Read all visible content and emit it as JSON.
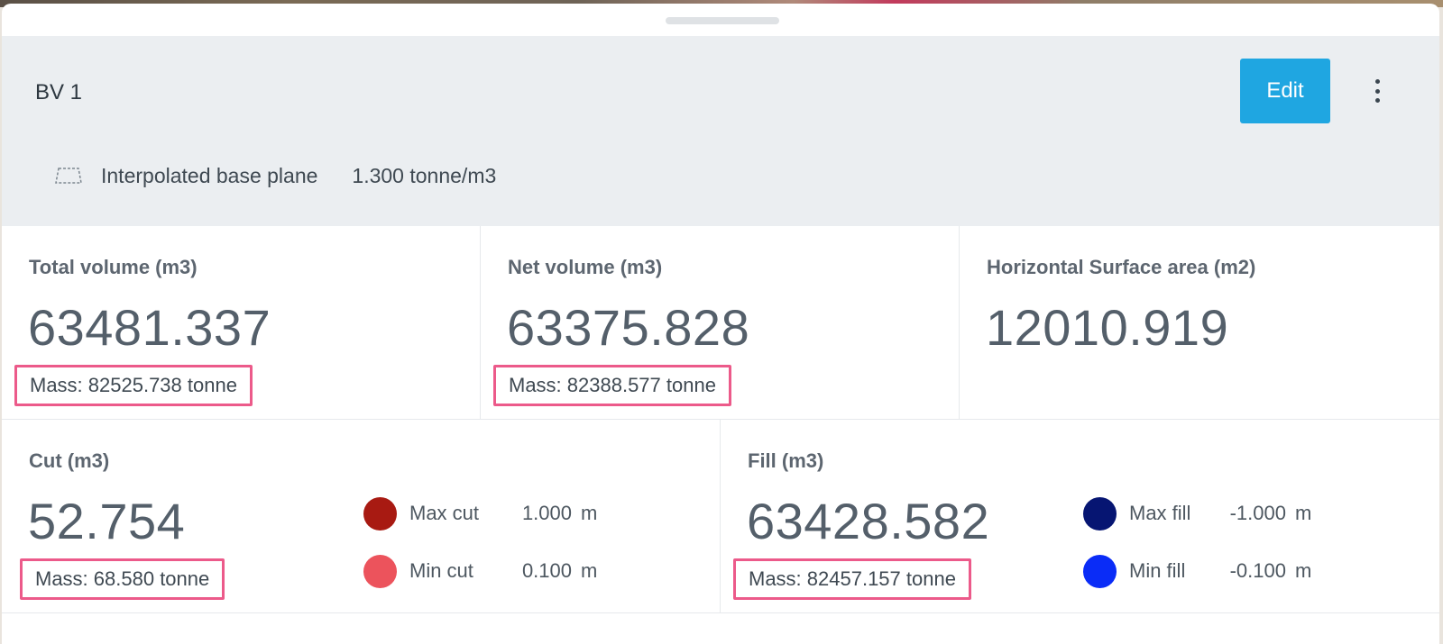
{
  "header": {
    "title": "BV 1",
    "edit_label": "Edit",
    "base_plane_label": "Interpolated base plane",
    "density": "1.300 tonne/m3"
  },
  "metrics": {
    "total_volume": {
      "label": "Total volume (m3)",
      "value": "63481.337",
      "mass": "Mass: 82525.738 tonne"
    },
    "net_volume": {
      "label": "Net volume (m3)",
      "value": "63375.828",
      "mass": "Mass: 82388.577 tonne"
    },
    "surface_area": {
      "label": "Horizontal Surface area (m2)",
      "value": "12010.919"
    },
    "cut": {
      "label": "Cut (m3)",
      "value": "52.754",
      "mass": "Mass: 68.580 tonne",
      "max_label": "Max cut",
      "max_value": "1.000",
      "max_unit": "m",
      "max_color": "#a81a12",
      "min_label": "Min cut",
      "min_value": "0.100",
      "min_unit": "m",
      "min_color": "#ec535c"
    },
    "fill": {
      "label": "Fill (m3)",
      "value": "63428.582",
      "mass": "Mass: 82457.157 tonne",
      "max_label": "Max fill",
      "max_value": "-1.000",
      "max_unit": "m",
      "max_color": "#061572",
      "min_label": "Min fill",
      "min_value": "-0.100",
      "min_unit": "m",
      "min_color": "#0a2cf7"
    }
  },
  "colors": {
    "accent": "#1fa6e1",
    "highlight_border": "#ec5a8a"
  },
  "icons": {
    "base_plane": "plane-outline-icon",
    "menu": "more-vertical-icon"
  }
}
